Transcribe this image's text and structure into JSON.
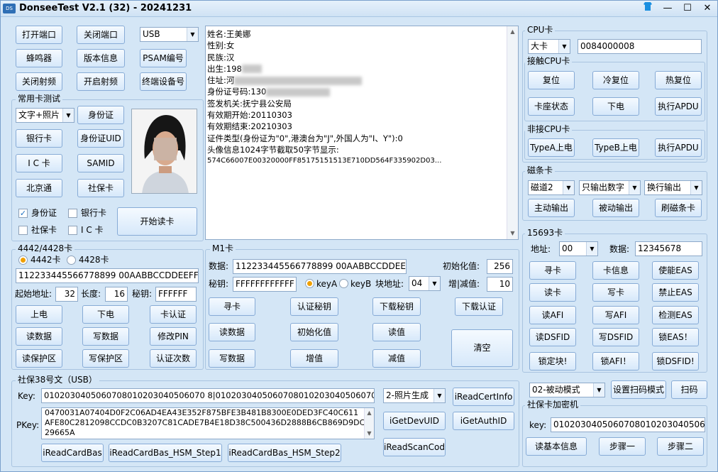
{
  "window": {
    "title": "DonseeTest V2.1  (32)  -  20241231",
    "icon": "DS"
  },
  "top": {
    "open_port": "打开端口",
    "close_port": "关闭端口",
    "port_type": "USB",
    "buzzer": "蜂鸣器",
    "version": "版本信息",
    "psam": "PSAM编号",
    "rf_off": "关闭射频",
    "rf_on": "开启射频",
    "terminal": "终端设备号"
  },
  "common": {
    "group": "常用卡测试",
    "mode": "文字+照片",
    "id_card": "身份证",
    "bank": "银行卡",
    "id_uid": "身份证UID",
    "ic": "I C 卡",
    "samid": "SAMID",
    "bjt": "北京通",
    "social": "社保卡",
    "cb_id": "身份证",
    "cb_bank": "银行卡",
    "cb_social": "社保卡",
    "cb_ic": "I C 卡",
    "start_read": "开始读卡"
  },
  "info": {
    "lines": [
      "姓名:王美娜",
      "性别:女",
      "民族:汉",
      "出生:198",
      "住址:河",
      "身份证号码:130",
      "签发机关:抚宁县公安局",
      "有效期开始:20110303",
      "有效期结束:20210303",
      "证件类型(身份证为\"0\",港澳台为\"J\",外国人为\"I、Y\"):0",
      "头像信息1024字节截取50字节显示:",
      "574C66007E00320000FF85175151513E710DD564F335902D03..."
    ]
  },
  "c4442": {
    "group": "4442/4428卡",
    "r1": "4442卡",
    "r2": "4428卡",
    "data": "112233445566778899 00AABBCCDDEEFF",
    "start_label": "起始地址:",
    "start": "32",
    "len_label": "长度:",
    "len": "16",
    "key_label": "秘钥:",
    "key": "FFFFFF",
    "power_on": "上电",
    "power_off": "下电",
    "auth": "卡认证",
    "read": "读数据",
    "write": "写数据",
    "pin": "修改PIN",
    "read_p": "读保护区",
    "write_p": "写保护区",
    "count": "认证次数"
  },
  "m1": {
    "group": "M1卡",
    "data_label": "数据:",
    "data": "112233445566778899 00AABBCCDDEEFF",
    "init_label": "初始化值:",
    "init": "256",
    "key_label": "秘钥:",
    "key": "FFFFFFFFFFFF",
    "ka": "keyA",
    "kb": "keyB",
    "block_label": "块地址:",
    "block": "04",
    "inc_label": "增|减值:",
    "inc": "10",
    "find": "寻卡",
    "auth_key": "认证秘钥",
    "dl_key": "下载秘钥",
    "dl_auth": "下载认证",
    "read": "读数据",
    "init_val": "初始化值",
    "read_val": "读值",
    "write": "写数据",
    "inc_btn": "增值",
    "dec_btn": "减值",
    "clear": "清空"
  },
  "ss38": {
    "group": "社保38号文（USB）",
    "key_label": "Key:",
    "key": "0102030405060708010203040506070 8|0102030405060708010203040506070 8|",
    "mode": "2-照片生成",
    "cert": "iReadCertInfo",
    "pkey_label": "PKey:",
    "pkey": [
      "0470031A07404D0F2C06AD4EA43E352F875BFE3B481B8300E0DED3FC40C611",
      "AFE80C2812098CCDC0B3207C81CADE7B4E18D38C500436D2888B6CB869D9DC",
      "29665A"
    ],
    "devuid": "iGetDevUID",
    "authid": "iGetAuthID",
    "bas": "iReadCardBas",
    "step1": "iReadCardBas_HSM_Step1",
    "step2": "iReadCardBas_HSM_Step2",
    "scan": "iReadScanCode"
  },
  "cpu": {
    "group": "CPU卡",
    "type": "大卡",
    "sam": "0084000008",
    "contact": "接触CPU卡",
    "reset": "复位",
    "cold": "冷复位",
    "hot": "热复位",
    "status": "卡座状态",
    "power_off": "下电",
    "apdu": "执行APDU",
    "contactless": "非接CPU卡",
    "typea": "TypeA上电",
    "typeb": "TypeB上电",
    "apdu2": "执行APDU"
  },
  "mag": {
    "group": "磁条卡",
    "track": "磁道2",
    "digits": "只输出数字",
    "newline": "换行输出",
    "active": "主动输出",
    "passive": "被动输出",
    "swipe": "刷磁条卡"
  },
  "c15693": {
    "group": "15693卡",
    "addr_label": "地址:",
    "addr": "00",
    "data_label": "数据:",
    "data": "12345678",
    "find": "寻卡",
    "info": "卡信息",
    "eas_on": "使能EAS",
    "read": "读卡",
    "write": "写卡",
    "eas_off": "禁止EAS",
    "rafi": "读AFI",
    "wafi": "写AFI",
    "eas_det": "检测EAS",
    "rdsfid": "读DSFID",
    "wdsfid": "写DSFID",
    "lock_eas": "锁EAS！",
    "lock_blk": "锁定块!",
    "lock_afi": "锁AFI！",
    "lock_dsfid": "锁DSFID!"
  },
  "scan": {
    "mode": "02-被动模式",
    "set": "设置扫码模式",
    "btn": "扫码"
  },
  "ssenc": {
    "group": "社保卡加密机",
    "key_label": "key:",
    "key": "0102030405060708010203040506070",
    "basic": "读基本信息",
    "s1": "步骤一",
    "s2": "步骤二"
  }
}
